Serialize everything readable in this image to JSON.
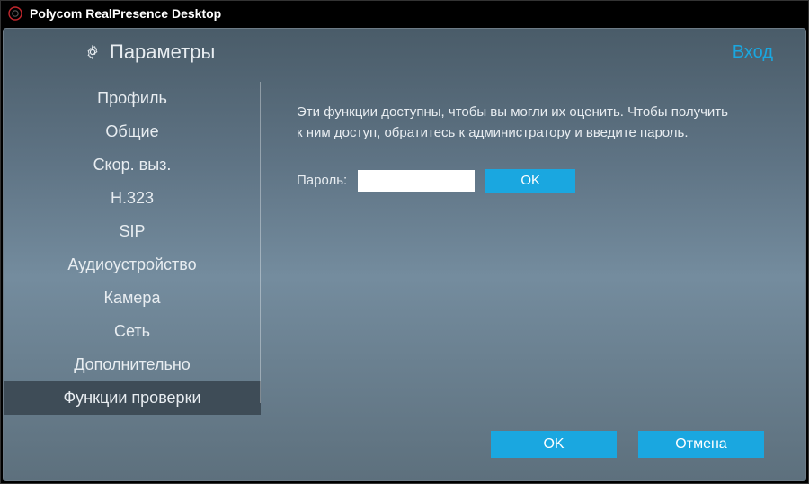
{
  "window": {
    "title": "Polycom RealPresence Desktop"
  },
  "header": {
    "title": "Параметры",
    "login": "Вход"
  },
  "sidebar": {
    "items": [
      {
        "label": "Профиль"
      },
      {
        "label": "Общие"
      },
      {
        "label": "Скор. выз."
      },
      {
        "label": "H.323"
      },
      {
        "label": "SIP"
      },
      {
        "label": "Аудиоустройство"
      },
      {
        "label": "Камера"
      },
      {
        "label": "Сеть"
      },
      {
        "label": "Дополнительно"
      },
      {
        "label": "Функции проверки"
      }
    ],
    "selected_index": 9
  },
  "main": {
    "description": "Эти функции доступны, чтобы вы могли их оценить. Чтобы получить к ним доступ, обратитесь к администратору и введите пароль.",
    "password_label": "Пароль:",
    "password_value": "",
    "password_ok": "OK"
  },
  "footer": {
    "ok": "OK",
    "cancel": "Отмена"
  },
  "colors": {
    "accent": "#1aa7e0"
  }
}
